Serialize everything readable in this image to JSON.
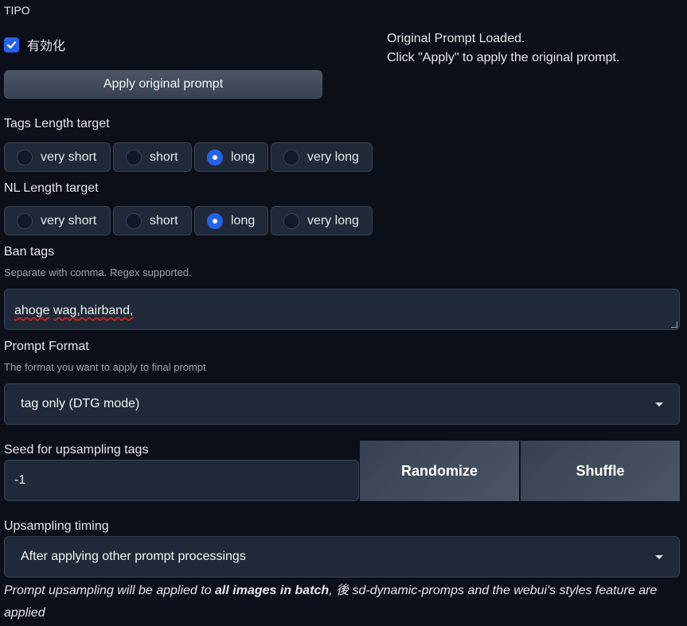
{
  "section": {
    "title": "TIPO"
  },
  "enable": {
    "label": "有効化",
    "checked": true
  },
  "status": {
    "line1": "Original Prompt Loaded.",
    "line2": "Click \"Apply\" to apply the original prompt."
  },
  "apply_button": {
    "label": "Apply original prompt"
  },
  "tags_length": {
    "label": "Tags Length target",
    "options": [
      "very short",
      "short",
      "long",
      "very long"
    ],
    "selected": "long"
  },
  "nl_length": {
    "label": "NL Length target",
    "options": [
      "very short",
      "short",
      "long",
      "very long"
    ],
    "selected": "long"
  },
  "ban_tags": {
    "label": "Ban tags",
    "info": "Separate with comma. Regex supported.",
    "value_word1": "ahoge",
    "value_word2": "wag",
    "value_rest": ",hairband,"
  },
  "prompt_format": {
    "label": "Prompt Format",
    "info": "The format you want to apply to final prompt",
    "value": "tag only (DTG mode)"
  },
  "seed": {
    "label": "Seed for upsampling tags",
    "value": "-1"
  },
  "randomize_button": {
    "label": "Randomize"
  },
  "shuffle_button": {
    "label": "Shuffle"
  },
  "upsampling_timing": {
    "label": "Upsampling timing",
    "value": "After applying other prompt processings"
  },
  "timing_info": {
    "part1": "Prompt upsampling will be applied to ",
    "bold": "all images in batch",
    "part2": ", 後 sd-dynamic-promps and the webui's styles feature are applied"
  },
  "colors": {
    "accent": "#2563eb",
    "background": "#0b0f19",
    "panel": "#1f2937"
  }
}
